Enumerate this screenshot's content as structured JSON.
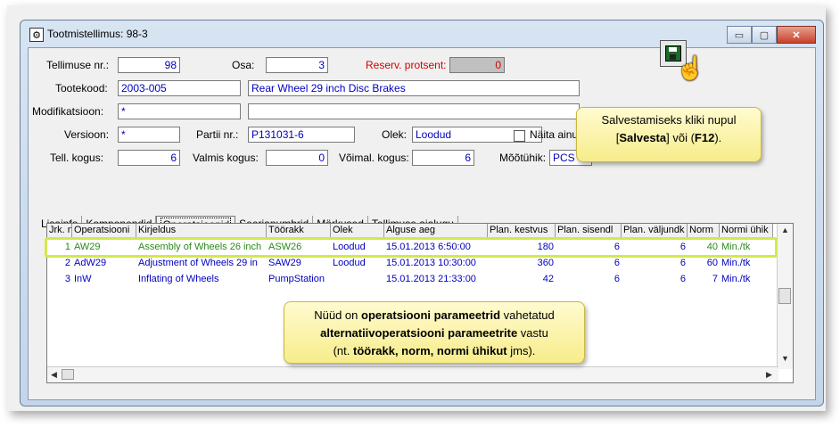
{
  "window": {
    "title": "Tootmistellimus: 98-3",
    "min_label": "▭",
    "max_label": "▢",
    "close_label": "✕"
  },
  "header": {
    "tellimuse_nr_label": "Tellimuse nr.:",
    "tellimuse_nr_value": "98",
    "osa_label": "Osa:",
    "osa_value": "3",
    "reserv_label": "Reserv. protsent:",
    "reserv_value": "0",
    "tootekood_label": "Tootekood:",
    "tootekood_value": "2003-005",
    "product_name": "Rear Wheel 29 inch Disc Brakes",
    "modifikatsioon_label": "Modifikatsioon:",
    "modifikatsioon_value": "*",
    "modifikatsioon_desc": "",
    "versioon_label": "Versioon:",
    "versioon_value": "*",
    "partii_label": "Partii nr.:",
    "partii_value": "P131031-6",
    "olek_label": "Olek:",
    "olek_value": "Loodud",
    "naita_label": "Näita ainul",
    "tell_kogus_label": "Tell. kogus:",
    "tell_kogus_value": "6",
    "valmis_label": "Valmis kogus:",
    "valmis_value": "0",
    "voimal_label": "Võimal. kogus:",
    "voimal_value": "6",
    "mootuhik_label": "Mõõtühik:",
    "mootuhik_value": "PCS"
  },
  "tabs": [
    "Lisainfo",
    "Komponendid",
    "Operatsioonid",
    "Seerianumbrid",
    "Märkused",
    "Tellimuse ajalugu"
  ],
  "active_tab": "Operatsioonid",
  "grid": {
    "columns": [
      "Jrk. n",
      "Operatsiooni",
      "Kirjeldus",
      "Töörakk",
      "Olek",
      "Alguse aeg",
      "Plan. kestvus",
      "Plan. sisendl",
      "Plan. väljundk",
      "Norm",
      "Normi ühik"
    ],
    "rows": [
      [
        "1",
        "AW29",
        "Assembly of Wheels 26 inch",
        "ASW26",
        "Loodud",
        "15.01.2013 6:50:00",
        "180",
        "6",
        "6",
        "40",
        "Min./tk"
      ],
      [
        "2",
        "AdW29",
        "Adjustment of Wheels 29 in",
        "SAW29",
        "Loodud",
        "15.01.2013 10:30:00",
        "360",
        "6",
        "6",
        "60",
        "Min./tk"
      ],
      [
        "3",
        "InW",
        "Inflating of Wheels",
        "PumpStation",
        "",
        "15.01.2013 21:33:00",
        "42",
        "6",
        "6",
        "7",
        "Min./tk"
      ]
    ]
  },
  "callout_save": {
    "line1": "Salvestamiseks kliki nupul",
    "pre": "[",
    "bold1": "Salvesta",
    "mid": "] või (",
    "bold2": "F12",
    "post": ")."
  },
  "callout_info": {
    "t1": "Nüüd on ",
    "b1": "operatsiooni parameetrid",
    "t2": " vahetatud",
    "b2": "alternatiivoperatsiooni parameetrite",
    "t3": " vastu",
    "t4": "(nt. ",
    "b3": "töörakk, norm, normi ühikut",
    "t5": " jms)."
  },
  "colors": {
    "highlight": "#d4e84a",
    "callout_bg": "#fbf3a8",
    "value_text": "#0000c0",
    "green_row": "#2a8a1a"
  }
}
